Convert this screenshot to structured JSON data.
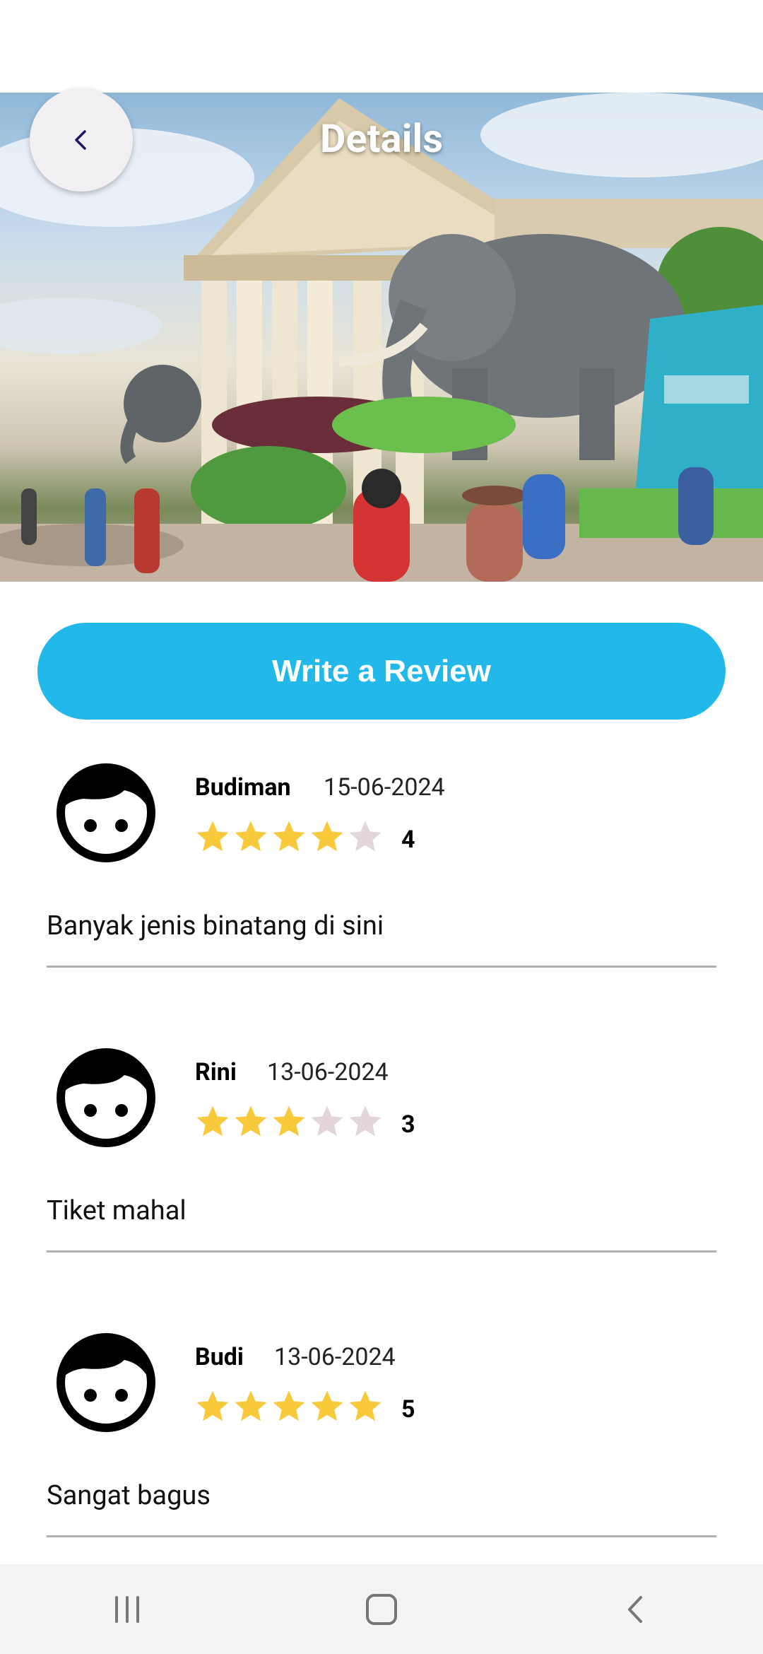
{
  "header": {
    "title": "Details",
    "back_icon": "chevron-left-icon"
  },
  "actions": {
    "write_review_label": "Write a Review"
  },
  "colors": {
    "accent": "#22b8ea",
    "star_filled": "#f8c93b",
    "star_empty": "#e4d6d8"
  },
  "reviews": [
    {
      "name": "Budiman",
      "date": "15-06-2024",
      "rating": 4,
      "rating_label": "4",
      "comment": "Banyak jenis binatang di sini"
    },
    {
      "name": "Rini",
      "date": "13-06-2024",
      "rating": 3,
      "rating_label": "3",
      "comment": "Tiket mahal"
    },
    {
      "name": "Budi",
      "date": "13-06-2024",
      "rating": 5,
      "rating_label": "5",
      "comment": "Sangat bagus"
    }
  ],
  "nav": {
    "recents_icon": "recents-icon",
    "home_icon": "home-icon",
    "back_icon": "back-arrow-icon"
  }
}
